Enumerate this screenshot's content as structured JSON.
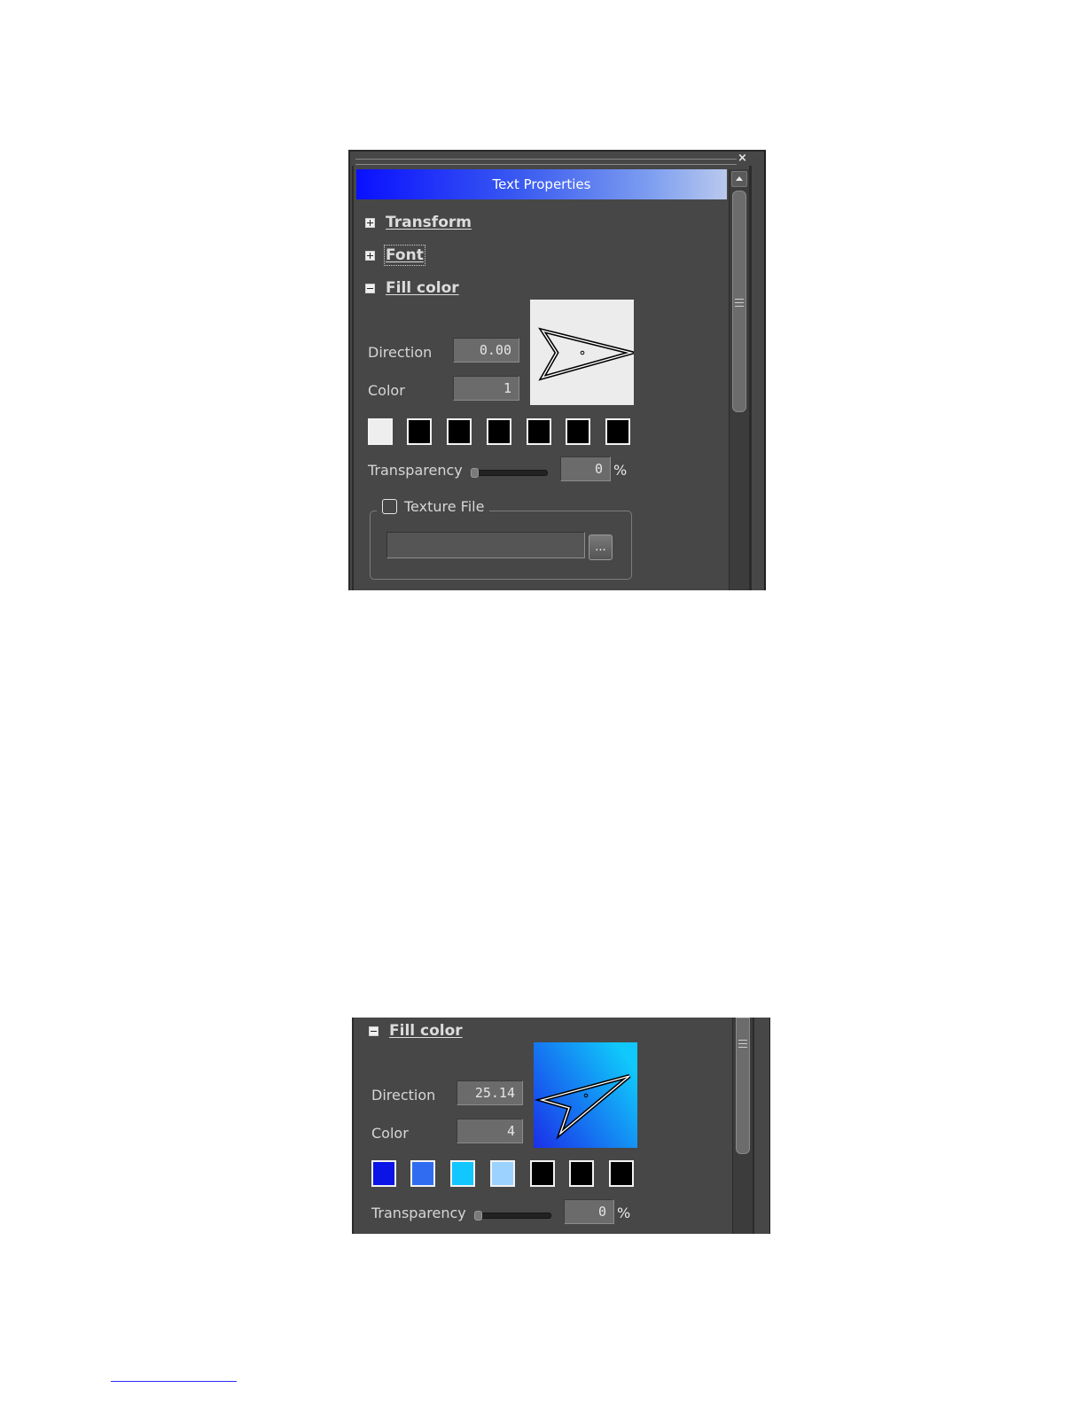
{
  "panel1": {
    "close_glyph": "×",
    "title": "Text Properties",
    "sections": [
      {
        "label": "Transform",
        "state": "collapsed",
        "toggle_icon": "plus-box-icon"
      },
      {
        "label": "Font",
        "state": "collapsed",
        "toggle_icon": "plus-box-icon"
      },
      {
        "label": "Fill color",
        "state": "expanded",
        "toggle_icon": "minus-box-icon"
      }
    ],
    "direction_label": "Direction",
    "direction_value": "0.00",
    "color_label": "Color",
    "color_value": "1",
    "swatches": [
      "#eeeeee",
      "#000000",
      "#000000",
      "#000000",
      "#000000",
      "#000000",
      "#000000"
    ],
    "preview_colors": [
      "#ececec",
      "#ececec"
    ],
    "transparency_label": "Transparency",
    "transparency_value": "0",
    "transparency_unit": "%",
    "texture_label": "Texture File",
    "texture_checked": false,
    "texture_path": "",
    "browse_label": "..."
  },
  "panel2": {
    "section": {
      "label": "Fill color",
      "state": "expanded",
      "toggle_icon": "minus-box-icon"
    },
    "direction_label": "Direction",
    "direction_value": "25.14",
    "color_label": "Color",
    "color_value": "4",
    "swatches": [
      "#0a14e6",
      "#2f6cf2",
      "#12c6ff",
      "#9cd2ff",
      "#000000",
      "#000000",
      "#000000"
    ],
    "preview_colors": [
      "#1a2fe8",
      "#10c8fb"
    ],
    "transparency_label": "Transparency",
    "transparency_value": "0",
    "transparency_unit": "%"
  }
}
